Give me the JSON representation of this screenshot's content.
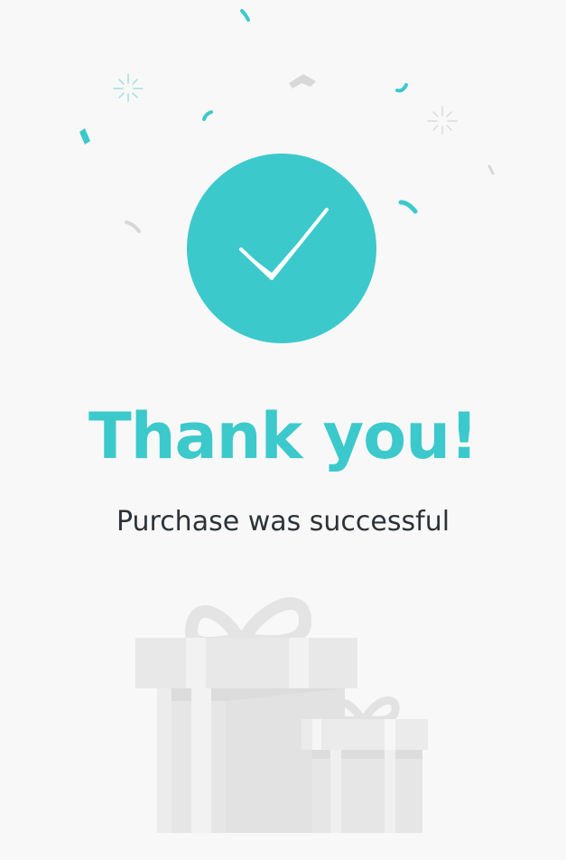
{
  "title": "Thank you!",
  "subtitle": "Purchase was successful",
  "colors": {
    "accent": "#3cc9cc",
    "background": "#f8f8f8",
    "subtitle_text": "#2c3338",
    "gift": "#e6e6e6",
    "gift_dark": "#dddddd",
    "gift_light": "#f0f0f0"
  },
  "icons": {
    "success": "checkmark-icon",
    "decoration": "confetti",
    "illustration": "gift-boxes"
  }
}
